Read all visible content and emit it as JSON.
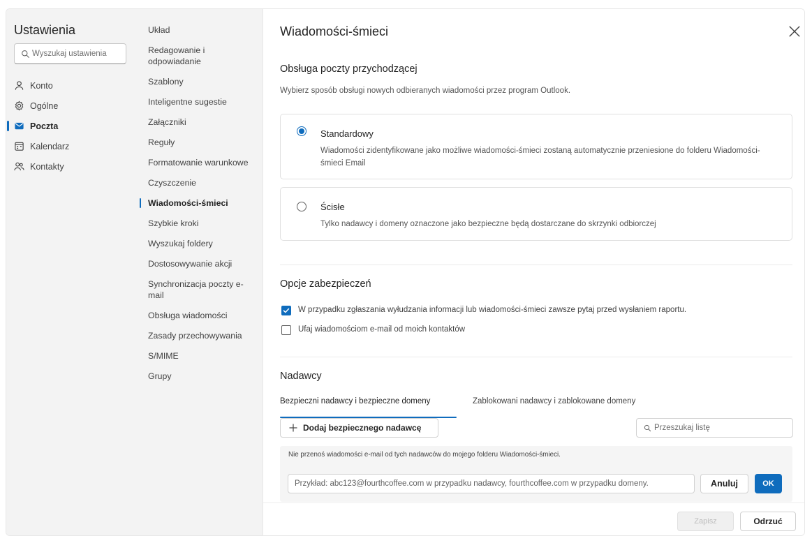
{
  "settings": {
    "title": "Ustawienia",
    "search_placeholder": "Wyszukaj ustawienia",
    "nav": [
      {
        "label": "Konto",
        "icon": "person-icon"
      },
      {
        "label": "Ogólne",
        "icon": "gear-icon"
      },
      {
        "label": "Poczta",
        "icon": "mail-icon",
        "active": true
      },
      {
        "label": "Kalendarz",
        "icon": "calendar-icon"
      },
      {
        "label": "Kontakty",
        "icon": "people-icon"
      }
    ]
  },
  "mail_nav": [
    "Układ",
    "Redagowanie i odpowiadanie",
    "Szablony",
    "Inteligentne sugestie",
    "Załączniki",
    "Reguły",
    "Formatowanie warunkowe",
    "Czyszczenie",
    "Wiadomości-śmieci",
    "Szybkie kroki",
    "Wyszukaj foldery",
    "Dostosowywanie akcji",
    "Synchronizacja poczty e-mail",
    "Obsługa wiadomości",
    "Zasady przechowywania",
    "S/MIME",
    "Grupy"
  ],
  "mail_nav_active": "Wiadomości-śmieci",
  "page": {
    "title": "Wiadomości-śmieci",
    "incoming": {
      "heading": "Obsługa poczty przychodzącej",
      "description": "Wybierz sposób obsługi nowych odbieranych wiadomości przez program Outlook.",
      "options": [
        {
          "label": "Standardowy",
          "description": "Wiadomości zidentyfikowane jako możliwe wiadomości-śmieci zostaną automatycznie przeniesione do folderu Wiadomości-śmieci Email",
          "selected": true
        },
        {
          "label": "Ścisłe",
          "description": "Tylko nadawcy i domeny oznaczone jako bezpieczne będą dostarczane do skrzynki odbiorczej",
          "selected": false
        }
      ]
    },
    "security": {
      "heading": "Opcje zabezpieczeń",
      "options": [
        {
          "label": "W przypadku zgłaszania wyłudzania informacji lub wiadomości-śmieci zawsze pytaj przed wysłaniem raportu.",
          "checked": true
        },
        {
          "label": "Ufaj wiadomościom e-mail od moich kontaktów",
          "checked": false
        }
      ]
    },
    "senders": {
      "heading": "Nadawcy",
      "tabs": [
        "Bezpieczni nadawcy i bezpieczne domeny",
        "Zablokowani nadawcy i zablokowane domeny"
      ],
      "active_tab": 0,
      "add_button": "Dodaj bezpiecznego nadawcę",
      "list_search_placeholder": "Przeszukaj listę",
      "note": "Nie przenoś wiadomości e-mail od tych nadawców do mojego folderu Wiadomości-śmieci.",
      "input_placeholder": "Przykład: abc123@fourthcoffee.com w przypadku nadawcy, fourthcoffee.com w przypadku domeny.",
      "cancel_button": "Anuluj",
      "ok_button": "OK"
    },
    "footer": {
      "save_button": "Zapisz",
      "discard_button": "Odrzuć",
      "save_disabled": true
    }
  },
  "colors": {
    "accent": "#0f6cbd",
    "sidebar_bg": "#f3f3f3"
  }
}
